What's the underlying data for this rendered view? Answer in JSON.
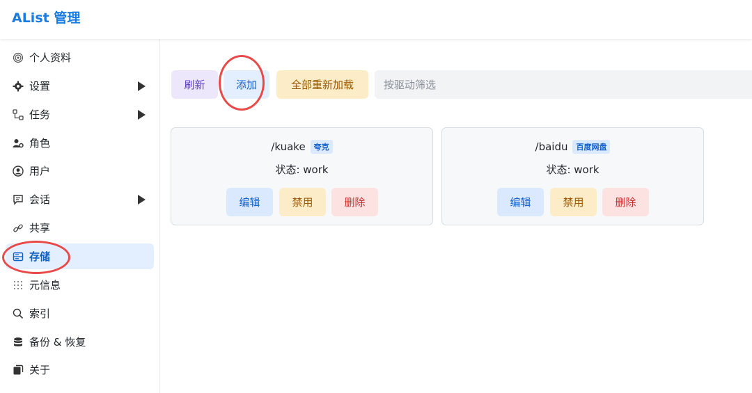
{
  "app": {
    "title": "AList 管理"
  },
  "sidebar": {
    "items": [
      {
        "label": "个人资料",
        "icon": "fingerprint-icon",
        "has_caret": false,
        "active": false
      },
      {
        "label": "设置",
        "icon": "gear-icon",
        "has_caret": true,
        "active": false
      },
      {
        "label": "任务",
        "icon": "flow-icon",
        "has_caret": true,
        "active": false
      },
      {
        "label": "角色",
        "icon": "user-gear-icon",
        "has_caret": false,
        "active": false
      },
      {
        "label": "用户",
        "icon": "user-circle-icon",
        "has_caret": false,
        "active": false
      },
      {
        "label": "会话",
        "icon": "chat-icon",
        "has_caret": true,
        "active": false
      },
      {
        "label": "共享",
        "icon": "link-icon",
        "has_caret": false,
        "active": false
      },
      {
        "label": "存储",
        "icon": "storage-icon",
        "has_caret": false,
        "active": true
      },
      {
        "label": "元信息",
        "icon": "grid-dots-icon",
        "has_caret": false,
        "active": false
      },
      {
        "label": "索引",
        "icon": "search-icon",
        "has_caret": false,
        "active": false
      },
      {
        "label": "备份 & 恢复",
        "icon": "database-icon",
        "has_caret": false,
        "active": false
      },
      {
        "label": "关于",
        "icon": "copy-icon",
        "has_caret": false,
        "active": false
      }
    ]
  },
  "toolbar": {
    "refresh_label": "刷新",
    "add_label": "添加",
    "reload_all_label": "全部重新加载",
    "filter_placeholder": "按驱动筛选"
  },
  "storages": [
    {
      "path": "/kuake",
      "driver": "夸克",
      "status": "状态: work",
      "edit": "编辑",
      "disable": "禁用",
      "delete": "删除"
    },
    {
      "path": "/baidu",
      "driver": "百度网盘",
      "status": "状态: work",
      "edit": "编辑",
      "disable": "禁用",
      "delete": "删除"
    }
  ],
  "colors": {
    "accent": "#1a7ce0",
    "active_bg": "#e3efff",
    "highlight_ring": "#e84a4a"
  }
}
